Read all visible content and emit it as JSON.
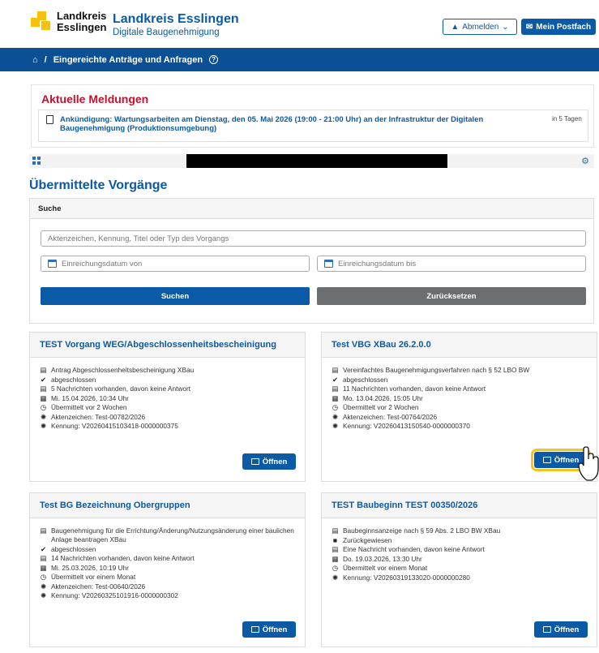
{
  "header": {
    "logo_line1": "Landkreis",
    "logo_line2": "Esslingen",
    "title": "Landkreis Esslingen",
    "subtitle": "Digitale Baugenehmigung",
    "logout_label": "Abmelden",
    "mailbox_label": "Mein Postfach"
  },
  "breadcrumb": {
    "separator": "/",
    "current": "Eingereichte Anträge und Anfragen",
    "help": "?"
  },
  "news": {
    "title": "Aktuelle Meldungen",
    "item_text": "Ankündigung: Wartungsarbeiten am Dienstag, den 05. Mai 2026 (19:00 - 21:00 Uhr) an der Infrastruktur der Digitalen Baugenehmigung (Produktionsumgebung)",
    "item_time": "in 5 Tagen"
  },
  "main": {
    "section_title": "Übermittelte Vorgänge"
  },
  "search": {
    "header": "Suche",
    "query_placeholder": "Aktenzeichen, Kennung, Titel oder Typ des Vorgangs",
    "date_from_placeholder": "Einreichungsdatum von",
    "date_to_placeholder": "Einreichungsdatum bis",
    "search_button": "Suchen",
    "reset_button": "Zurücksetzen"
  },
  "cards": [
    {
      "title": "TEST Vorgang WEG/Abgeschlossenheitsbescheinigung",
      "type": "Antrag Abgeschlossenheitsbescheinigung XBau",
      "status": "abgeschlossen",
      "messages": "5 Nachrichten vorhanden, davon keine Antwort",
      "date": "Mi. 15.04.2026, 10:34 Uhr",
      "sent": "Übermittelt vor 2 Wochen",
      "file_no": "Aktenzeichen: Test-00782/2026",
      "id": "Kennung: V20260415103418-0000000375",
      "open": "Öffnen"
    },
    {
      "title": "Test VBG XBau 26.2.0.0",
      "type": "Vereinfachtes Baugenehmigungsverfahren nach § 52 LBO BW",
      "status": "abgeschlossen",
      "messages": "11 Nachrichten vorhanden, davon keine Antwort",
      "date": "Mo. 13.04.2026, 15:05 Uhr",
      "sent": "Übermittelt vor 2 Wochen",
      "file_no": "Aktenzeichen: Test-00764/2026",
      "id": "Kennung: V20260413150540-0000000370",
      "open": "Öffnen"
    },
    {
      "title": "Test BG Bezeichnung Obergruppen",
      "type": "Baugenehmigung für die Errichtung/Änderung/Nutzungsänderung einer baulichen Anlage beantragen XBau",
      "status": "abgeschlossen",
      "messages": "14 Nachrichten vorhanden, davon keine Antwort",
      "date": "Mi. 25.03.2026, 10:19 Uhr",
      "sent": "Übermittelt vor einem Monat",
      "file_no": "Aktenzeichen: Test-00640/2026",
      "id": "Kennung: V20260325101916-0000000302",
      "open": "Öffnen"
    },
    {
      "title": "TEST Baubeginn TEST 00350/2026",
      "type": "Baubeginnsanzeige nach § 59 Abs. 2 LBO BW XBau",
      "status": "Zurückgewiesen",
      "messages": "Eine Nachricht vorhanden, davon keine Antwort",
      "date": "Do. 19.03.2026, 13:30 Uhr",
      "sent": "Übermittelt vor einem Monat",
      "id": "Kennung: V20260319133020-0000000280",
      "open": "Öffnen"
    }
  ]
}
